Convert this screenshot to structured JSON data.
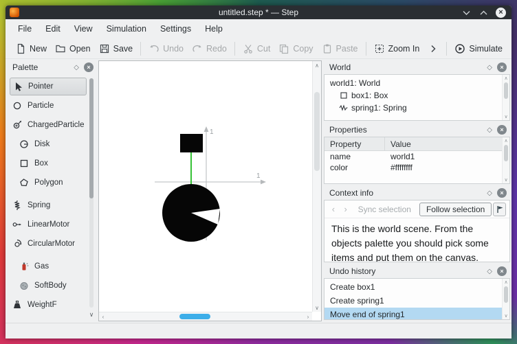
{
  "window": {
    "title": "untitled.step * — Step"
  },
  "icons": {
    "close": "×",
    "float": "◇",
    "chevron_up": "∧",
    "chevron_down": "∨",
    "chevron_left": "‹",
    "chevron_right": "›"
  },
  "menubar": {
    "items": [
      "File",
      "Edit",
      "View",
      "Simulation",
      "Settings",
      "Help"
    ]
  },
  "toolbar": {
    "new": "New",
    "open": "Open",
    "save": "Save",
    "undo": "Undo",
    "redo": "Redo",
    "cut": "Cut",
    "copy": "Copy",
    "paste": "Paste",
    "zoom_in": "Zoom In",
    "simulate": "Simulate"
  },
  "palette": {
    "title": "Palette",
    "items": [
      {
        "label": "Pointer",
        "icon": "pointer-icon"
      },
      {
        "label": "Particle",
        "icon": "particle-icon"
      },
      {
        "label": "ChargedParticle",
        "icon": "charged-particle-icon"
      },
      {
        "label": "Disk",
        "icon": "disk-icon"
      },
      {
        "label": "Box",
        "icon": "box-icon"
      },
      {
        "label": "Polygon",
        "icon": "polygon-icon"
      },
      {
        "label": "Spring",
        "icon": "spring-icon"
      },
      {
        "label": "LinearMotor",
        "icon": "linear-motor-icon"
      },
      {
        "label": "CircularMotor",
        "icon": "circular-motor-icon"
      },
      {
        "label": "Gas",
        "icon": "gas-icon"
      },
      {
        "label": "SoftBody",
        "icon": "softbody-icon"
      },
      {
        "label": "WeightF",
        "icon": "weight-icon"
      }
    ]
  },
  "canvas": {
    "x_axis_label": "1",
    "y_axis_label": "1"
  },
  "world_panel": {
    "title": "World",
    "items": [
      {
        "label": "world1: World"
      },
      {
        "label": "box1: Box",
        "icon": "box-icon"
      },
      {
        "label": "spring1: Spring",
        "icon": "spring-icon"
      }
    ]
  },
  "properties_panel": {
    "title": "Properties",
    "columns": [
      "Property",
      "Value"
    ],
    "rows": [
      [
        "name",
        "world1"
      ],
      [
        "color",
        "#ffffffff"
      ]
    ]
  },
  "context_panel": {
    "title": "Context info",
    "sync_label": "Sync selection",
    "follow_label": "Follow selection",
    "body_text": "This is the world scene. From the objects palette you should pick some items and put them on the canvas."
  },
  "undo_panel": {
    "title": "Undo history",
    "items": [
      "Create box1",
      "Create spring1",
      "Move end of spring1"
    ],
    "selected_index": 2
  },
  "colors": {
    "selection": "#3daee9",
    "spring_green": "#35c135",
    "titlebar": "#2a2e32"
  }
}
